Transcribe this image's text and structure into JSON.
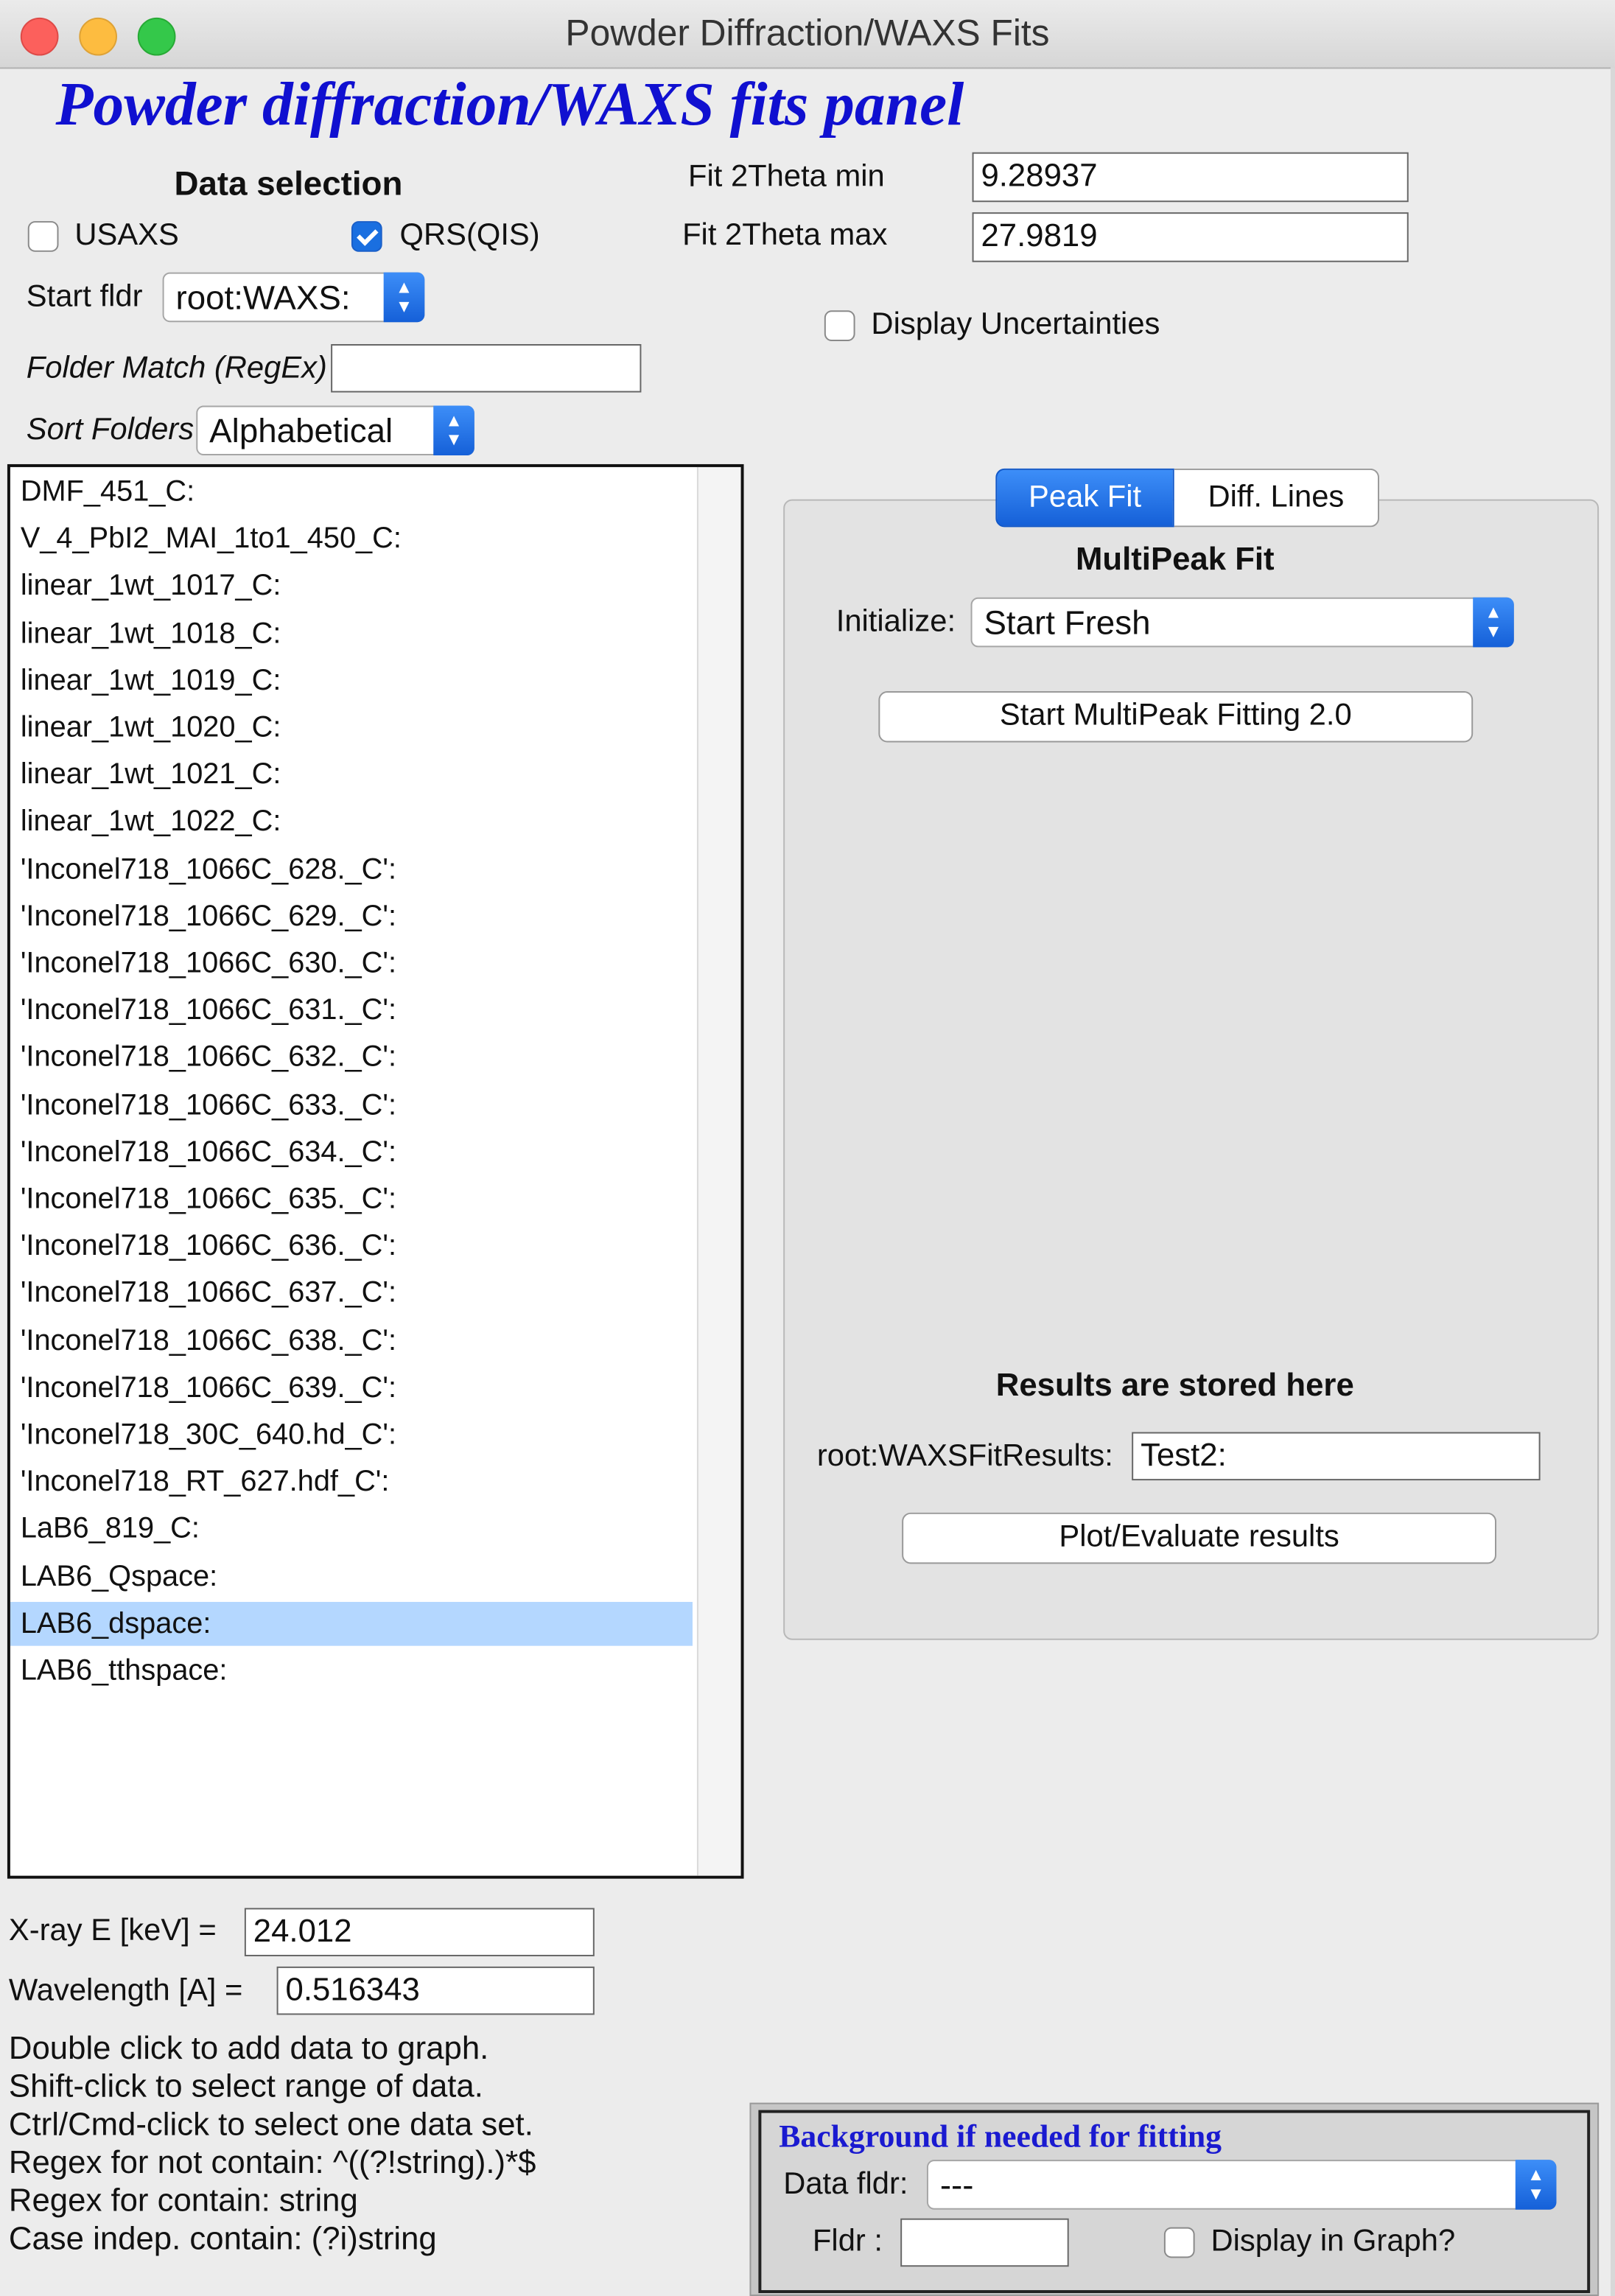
{
  "window": {
    "title": "Powder Diffraction/WAXS Fits"
  },
  "panel": {
    "title": "Powder diffraction/WAXS fits panel"
  },
  "data_selection": {
    "heading": "Data selection",
    "usaxs_label": "USAXS",
    "usaxs_checked": false,
    "qrs_label": "QRS(QIS)",
    "qrs_checked": true,
    "start_folder_label": "Start fldr",
    "start_folder_value": "root:WAXS:",
    "folder_match_label": "Folder Match (RegEx)",
    "folder_match_value": "",
    "sort_folders_label": "Sort Folders",
    "sort_folders_value": "Alphabetical"
  },
  "fit_range": {
    "min_label": "Fit 2Theta min",
    "min_value": "9.28937",
    "max_label": "Fit 2Theta max",
    "max_value": "27.9819"
  },
  "display_uncertainties": {
    "label": "Display Uncertainties",
    "checked": false
  },
  "folder_list": {
    "items": [
      "DMF_451_C:",
      "V_4_PbI2_MAI_1to1_450_C:",
      "linear_1wt_1017_C:",
      "linear_1wt_1018_C:",
      "linear_1wt_1019_C:",
      "linear_1wt_1020_C:",
      "linear_1wt_1021_C:",
      "linear_1wt_1022_C:",
      "'Inconel718_1066C_628._C':",
      "'Inconel718_1066C_629._C':",
      "'Inconel718_1066C_630._C':",
      "'Inconel718_1066C_631._C':",
      "'Inconel718_1066C_632._C':",
      "'Inconel718_1066C_633._C':",
      "'Inconel718_1066C_634._C':",
      "'Inconel718_1066C_635._C':",
      "'Inconel718_1066C_636._C':",
      "'Inconel718_1066C_637._C':",
      "'Inconel718_1066C_638._C':",
      "'Inconel718_1066C_639._C':",
      "'Inconel718_30C_640.hd_C':",
      "'Inconel718_RT_627.hdf_C':",
      "LaB6_819_C:",
      "LAB6_Qspace:",
      "LAB6_dspace:",
      "LAB6_tthspace:"
    ],
    "selected": "LAB6_dspace:"
  },
  "xray": {
    "energy_label": "X-ray E [keV] =",
    "energy_value": "24.012",
    "wavelength_label": "Wavelength [A] =",
    "wavelength_value": "0.516343"
  },
  "help": {
    "lines": [
      "Double click to add data to graph.",
      "Shift-click to select range of data.",
      "Ctrl/Cmd-click to select one data set.",
      "Regex for not contain: ^((?!string).)*$",
      "Regex for contain:  string",
      "Case indep. contain:  (?i)string"
    ]
  },
  "tabs": {
    "peak_fit": "Peak Fit",
    "diff_lines": "Diff. Lines",
    "active": "Peak Fit"
  },
  "multipeak": {
    "heading": "MultiPeak Fit",
    "initialize_label": "Initialize:",
    "initialize_value": "Start Fresh",
    "start_button": "Start MultiPeak Fitting 2.0",
    "results_heading": "Results are stored here",
    "results_folder_label": "root:WAXSFitResults:",
    "results_folder_value": "Test2:",
    "plot_button": "Plot/Evaluate results"
  },
  "background": {
    "title": "Background if needed for fitting",
    "data_folder_label": "Data fldr:",
    "data_folder_value": "---",
    "folder_label": "Fldr :",
    "folder_value": "",
    "display_label": "Display in Graph?",
    "display_checked": false
  },
  "colors": {
    "panel_title": "#1010d0",
    "accent_blue": "#1a6fe0",
    "list_selection": "#b4d7ff",
    "window_bg": "#ececec"
  },
  "icons": [
    "close-button-icon",
    "minimize-button-icon",
    "zoom-button-icon",
    "checkmark-icon",
    "up-down-chevron-icon"
  ]
}
